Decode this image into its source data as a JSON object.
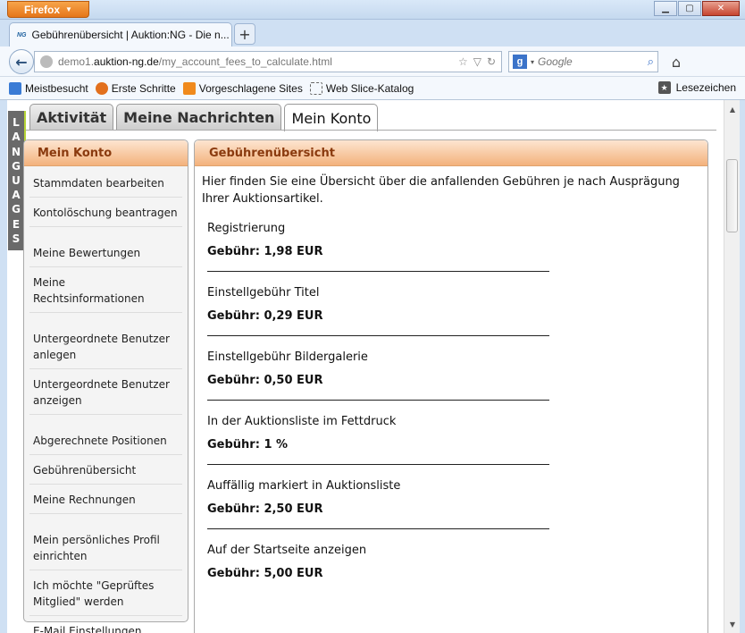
{
  "browser": {
    "app_button": "Firefox",
    "tab_title": "Gebührenübersicht | Auktion:NG - Die n...",
    "tab_favicon": "NG",
    "url_prefix": "demo1.",
    "url_domain": "auktion-ng.de",
    "url_path": "/my_account_fees_to_calculate.html",
    "search_placeholder": "Google",
    "bookmarks": [
      {
        "label": "Meistbesucht",
        "icon": "most-visited-icon"
      },
      {
        "label": "Erste Schritte",
        "icon": "firefox-icon"
      },
      {
        "label": "Vorgeschlagene Sites",
        "icon": "suggested-sites-icon"
      },
      {
        "label": "Web Slice-Katalog",
        "icon": "web-slice-icon"
      }
    ],
    "bookmarks_menu": "Lesezeichen"
  },
  "page": {
    "languages_label": [
      "L",
      "A",
      "N",
      "G",
      "U",
      "A",
      "G",
      "E",
      "S"
    ],
    "tabs": [
      {
        "label": "Aktivität",
        "active": false
      },
      {
        "label": "Meine Nachrichten",
        "active": false
      },
      {
        "label": "Mein Konto",
        "active": true
      }
    ],
    "sidebar": {
      "title": "Mein Konto",
      "groups": [
        [
          "Stammdaten bearbeiten",
          "Kontolöschung beantragen"
        ],
        [
          "Meine Bewertungen",
          "Meine Rechtsinformationen"
        ],
        [
          "Untergeordnete Benutzer anlegen",
          "Untergeordnete Benutzer anzeigen"
        ],
        [
          "Abgerechnete Positionen",
          "Gebührenübersicht",
          "Meine Rechnungen"
        ],
        [
          "Mein persönliches Profil einrichten",
          "Ich möchte \"Geprüftes Mitglied\" werden",
          "E-Mail Einstellungen"
        ]
      ]
    },
    "content": {
      "title": "Gebührenübersicht",
      "intro": "Hier finden Sie eine Übersicht über die anfallenden Gebühren je nach Ausprägung Ihrer Auktionsartikel.",
      "fees": [
        {
          "label": "Registrierung",
          "value": "Gebühr: 1,98 EUR"
        },
        {
          "label": "Einstellgebühr Titel",
          "value": "Gebühr: 0,29 EUR"
        },
        {
          "label": "Einstellgebühr Bildergalerie",
          "value": "Gebühr: 0,50 EUR"
        },
        {
          "label": "In der Auktionsliste im Fettdruck",
          "value": "Gebühr: 1 %"
        },
        {
          "label": "Auffällig markiert in Auktionsliste",
          "value": "Gebühr: 2,50 EUR"
        },
        {
          "label": "Auf der Startseite anzeigen",
          "value": "Gebühr: 5,00 EUR"
        }
      ]
    }
  }
}
